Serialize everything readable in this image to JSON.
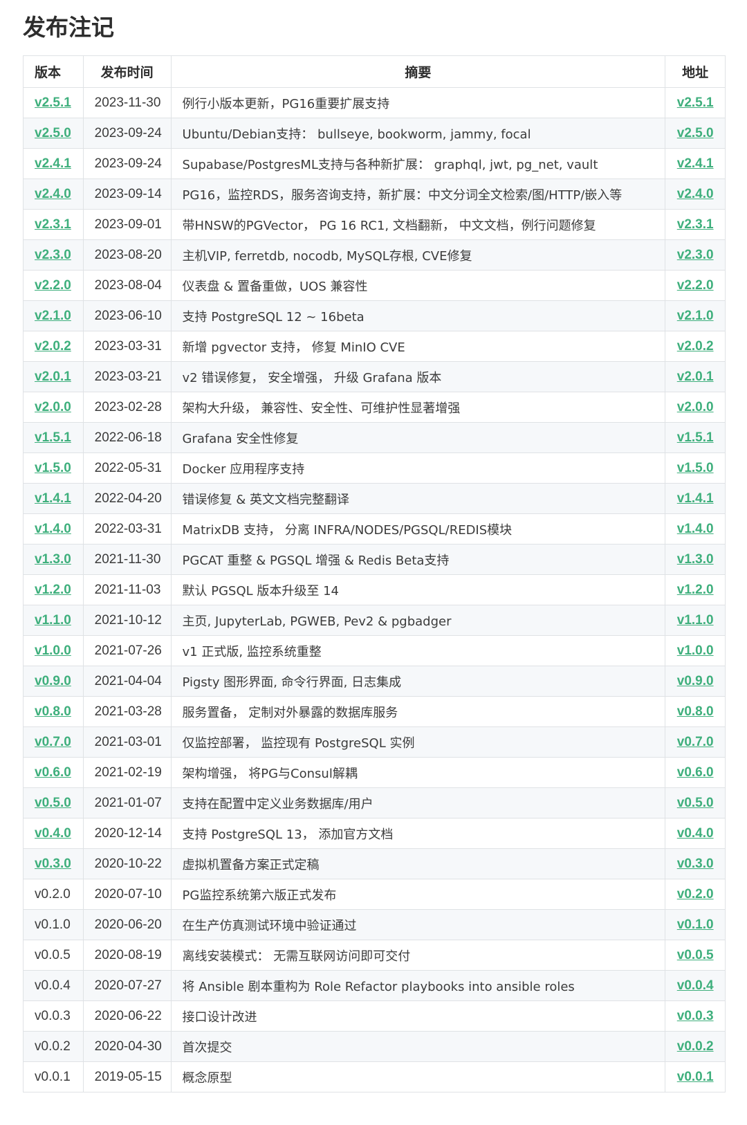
{
  "page": {
    "title": "发布注记"
  },
  "table": {
    "headers": {
      "version": "版本",
      "date": "发布时间",
      "summary": "摘要",
      "url": "地址"
    },
    "rows": [
      {
        "version": "v2.5.1",
        "linked": true,
        "date": "2023-11-30",
        "summary": "例行小版本更新，PG16重要扩展支持",
        "url": "v2.5.1"
      },
      {
        "version": "v2.5.0",
        "linked": true,
        "date": "2023-09-24",
        "summary": "Ubuntu/Debian支持： bullseye, bookworm, jammy, focal",
        "url": "v2.5.0"
      },
      {
        "version": "v2.4.1",
        "linked": true,
        "date": "2023-09-24",
        "summary": "Supabase/PostgresML支持与各种新扩展： graphql, jwt, pg_net, vault",
        "url": "v2.4.1"
      },
      {
        "version": "v2.4.0",
        "linked": true,
        "date": "2023-09-14",
        "summary": "PG16，监控RDS，服务咨询支持，新扩展：中文分词全文检索/图/HTTP/嵌入等",
        "url": "v2.4.0"
      },
      {
        "version": "v2.3.1",
        "linked": true,
        "date": "2023-09-01",
        "summary": "带HNSW的PGVector， PG 16 RC1, 文档翻新， 中文文档，例行问题修复",
        "url": "v2.3.1"
      },
      {
        "version": "v2.3.0",
        "linked": true,
        "date": "2023-08-20",
        "summary": "主机VIP, ferretdb, nocodb, MySQL存根, CVE修复",
        "url": "v2.3.0"
      },
      {
        "version": "v2.2.0",
        "linked": true,
        "date": "2023-08-04",
        "summary": "仪表盘 & 置备重做，UOS 兼容性",
        "url": "v2.2.0"
      },
      {
        "version": "v2.1.0",
        "linked": true,
        "date": "2023-06-10",
        "summary": "支持 PostgreSQL 12 ~ 16beta",
        "url": "v2.1.0"
      },
      {
        "version": "v2.0.2",
        "linked": true,
        "date": "2023-03-31",
        "summary": "新增 pgvector 支持， 修复 MinIO CVE",
        "url": "v2.0.2"
      },
      {
        "version": "v2.0.1",
        "linked": true,
        "date": "2023-03-21",
        "summary": "v2 错误修复， 安全增强， 升级 Grafana 版本",
        "url": "v2.0.1"
      },
      {
        "version": "v2.0.0",
        "linked": true,
        "date": "2023-02-28",
        "summary": "架构大升级， 兼容性、安全性、可维护性显著增强",
        "url": "v2.0.0"
      },
      {
        "version": "v1.5.1",
        "linked": true,
        "date": "2022-06-18",
        "summary": "Grafana 安全性修复",
        "url": "v1.5.1"
      },
      {
        "version": "v1.5.0",
        "linked": true,
        "date": "2022-05-31",
        "summary": "Docker 应用程序支持",
        "url": "v1.5.0"
      },
      {
        "version": "v1.4.1",
        "linked": true,
        "date": "2022-04-20",
        "summary": "错误修复 & 英文文档完整翻译",
        "url": "v1.4.1"
      },
      {
        "version": "v1.4.0",
        "linked": true,
        "date": "2022-03-31",
        "summary": "MatrixDB 支持， 分离 INFRA/NODES/PGSQL/REDIS模块",
        "url": "v1.4.0"
      },
      {
        "version": "v1.3.0",
        "linked": true,
        "date": "2021-11-30",
        "summary": "PGCAT 重整 & PGSQL 增强 & Redis Beta支持",
        "url": "v1.3.0"
      },
      {
        "version": "v1.2.0",
        "linked": true,
        "date": "2021-11-03",
        "summary": "默认 PGSQL 版本升级至 14",
        "url": "v1.2.0"
      },
      {
        "version": "v1.1.0",
        "linked": true,
        "date": "2021-10-12",
        "summary": "主页, JupyterLab, PGWEB, Pev2 & pgbadger",
        "url": "v1.1.0"
      },
      {
        "version": "v1.0.0",
        "linked": true,
        "date": "2021-07-26",
        "summary": "v1 正式版, 监控系统重整",
        "url": "v1.0.0"
      },
      {
        "version": "v0.9.0",
        "linked": true,
        "date": "2021-04-04",
        "summary": "Pigsty 图形界面, 命令行界面, 日志集成",
        "url": "v0.9.0"
      },
      {
        "version": "v0.8.0",
        "linked": true,
        "date": "2021-03-28",
        "summary": "服务置备， 定制对外暴露的数据库服务",
        "url": "v0.8.0"
      },
      {
        "version": "v0.7.0",
        "linked": true,
        "date": "2021-03-01",
        "summary": "仅监控部署， 监控现有 PostgreSQL 实例",
        "url": "v0.7.0"
      },
      {
        "version": "v0.6.0",
        "linked": true,
        "date": "2021-02-19",
        "summary": "架构增强， 将PG与Consul解耦",
        "url": "v0.6.0"
      },
      {
        "version": "v0.5.0",
        "linked": true,
        "date": "2021-01-07",
        "summary": "支持在配置中定义业务数据库/用户",
        "url": "v0.5.0"
      },
      {
        "version": "v0.4.0",
        "linked": true,
        "date": "2020-12-14",
        "summary": "支持 PostgreSQL 13， 添加官方文档",
        "url": "v0.4.0"
      },
      {
        "version": "v0.3.0",
        "linked": true,
        "date": "2020-10-22",
        "summary": "虚拟机置备方案正式定稿",
        "url": "v0.3.0"
      },
      {
        "version": "v0.2.0",
        "linked": false,
        "date": "2020-07-10",
        "summary": "PG监控系统第六版正式发布",
        "url": "v0.2.0"
      },
      {
        "version": "v0.1.0",
        "linked": false,
        "date": "2020-06-20",
        "summary": "在生产仿真测试环境中验证通过",
        "url": "v0.1.0"
      },
      {
        "version": "v0.0.5",
        "linked": false,
        "date": "2020-08-19",
        "summary": "离线安装模式： 无需互联网访问即可交付",
        "url": "v0.0.5"
      },
      {
        "version": "v0.0.4",
        "linked": false,
        "date": "2020-07-27",
        "summary": "将 Ansible 剧本重构为 Role Refactor playbooks into ansible roles",
        "url": "v0.0.4"
      },
      {
        "version": "v0.0.3",
        "linked": false,
        "date": "2020-06-22",
        "summary": "接口设计改进",
        "url": "v0.0.3"
      },
      {
        "version": "v0.0.2",
        "linked": false,
        "date": "2020-04-30",
        "summary": "首次提交",
        "url": "v0.0.2"
      },
      {
        "version": "v0.0.1",
        "linked": false,
        "date": "2019-05-15",
        "summary": "概念原型",
        "url": "v0.0.1"
      }
    ]
  }
}
